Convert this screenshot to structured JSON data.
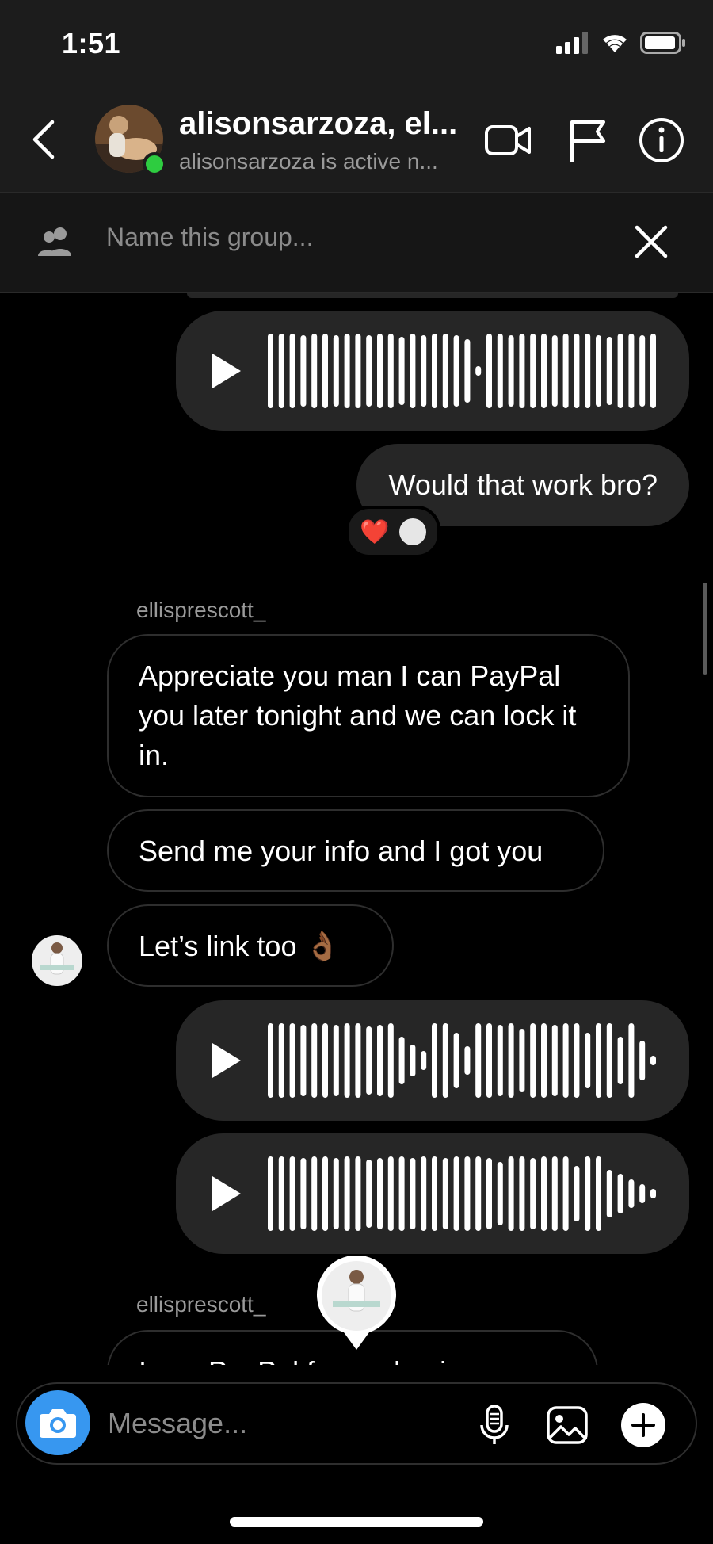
{
  "status": {
    "time": "1:51"
  },
  "header": {
    "title": "alisonsarzoza, el...",
    "subtitle": "alisonsarzoza is active n..."
  },
  "group": {
    "placeholder": "Name this group..."
  },
  "messages": {
    "out_text": "Would that work bro?",
    "reaction_emoji": "❤️",
    "sender_1": "ellisprescott_",
    "in_1": "Appreciate you man I can PayPal you later tonight and we can lock it in.",
    "in_2": "Send me your info and I got you",
    "in_3": "Let’s link too 👌🏾",
    "sender_2": "ellisprescott_",
    "partial": "I use PayPal for my business"
  },
  "composer": {
    "placeholder": "Message..."
  },
  "colors": {
    "accent": "#3797f0",
    "online": "#2ecc40",
    "bubble": "#262626"
  },
  "icons": [
    "back-icon",
    "video-call-icon",
    "flag-icon",
    "info-icon",
    "group-icon",
    "close-icon",
    "play-icon",
    "camera-icon",
    "microphone-icon",
    "gallery-icon",
    "plus-icon"
  ]
}
